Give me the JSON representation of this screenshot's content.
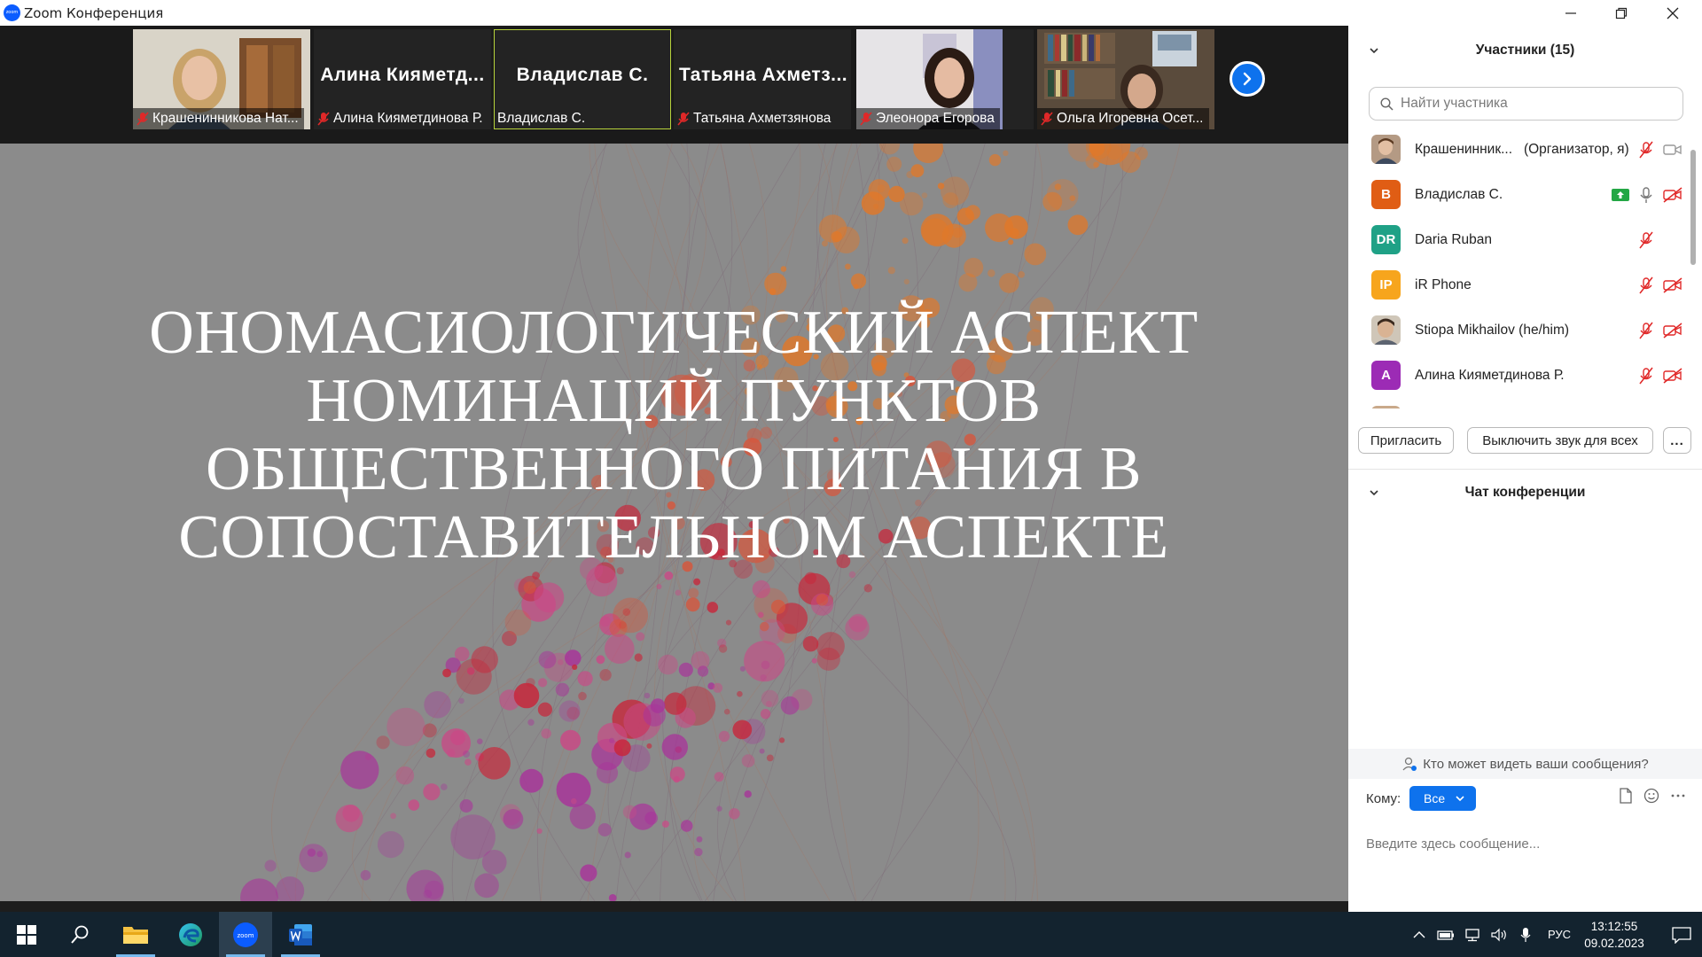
{
  "window": {
    "title": "Zoom Конференция",
    "app_logo_text": "zoom",
    "controls": [
      "minimize",
      "restore",
      "close"
    ]
  },
  "video_strip": {
    "tiles": [
      {
        "display_name": "",
        "label": "Крашенинникова Нат...",
        "muted": true,
        "has_video": true,
        "active": false
      },
      {
        "display_name": "Алина Кияметд...",
        "label": "Алина Кияметдинова Р.",
        "muted": true,
        "has_video": false,
        "active": false
      },
      {
        "display_name": "Владислав С.",
        "label": "Владислав С.",
        "muted": false,
        "has_video": false,
        "active": true
      },
      {
        "display_name": "Татьяна Ахметз...",
        "label": "Татьяна Ахметзянова",
        "muted": true,
        "has_video": false,
        "active": false
      },
      {
        "display_name": "",
        "label": "Элеонора Егорова",
        "muted": true,
        "has_video": true,
        "active": false
      },
      {
        "display_name": "",
        "label": "Ольга Игоревна Осет...",
        "muted": true,
        "has_video": true,
        "active": false
      }
    ],
    "next_icon": "chevron-right-icon"
  },
  "slide": {
    "title_lines": [
      "ОНОМАСИОЛОГИЧЕСКИЙ АСПЕКТ",
      "НОМИНАЦИЙ ПУНКТОВ",
      "ОБЩЕСТВЕННОГО ПИТАНИЯ В",
      "СОПОСТАВИТЕЛЬНОМ АСПЕКТЕ"
    ],
    "background_color": "#8b8b8b"
  },
  "participants": {
    "header": "Участники (15)",
    "search_placeholder": "Найти участника",
    "list": [
      {
        "name": "Крашенинник...",
        "role": "(Организатор, я)",
        "avatar_text": "",
        "avatar_color": "#8a6a55",
        "icons": [
          "mic-muted-icon",
          "video-icon"
        ]
      },
      {
        "name": "Владислав С.",
        "role": "",
        "avatar_text": "В",
        "avatar_color": "#e05d14",
        "icons": [
          "share-screen-icon",
          "mic-icon",
          "video-off-icon"
        ]
      },
      {
        "name": "Daria Ruban",
        "role": "",
        "avatar_text": "DR",
        "avatar_color": "#1fa186",
        "icons": [
          "mic-muted-icon"
        ]
      },
      {
        "name": "iR Phone",
        "role": "",
        "avatar_text": "IP",
        "avatar_color": "#f7a51d",
        "icons": [
          "mic-muted-icon",
          "video-off-icon"
        ]
      },
      {
        "name": "Stiopa Mikhailov (he/him)",
        "role": "",
        "avatar_text": "",
        "avatar_color": "#9a8b7c",
        "icons": [
          "mic-muted-icon",
          "video-off-icon"
        ]
      },
      {
        "name": "Алина Кияметдинова Р.",
        "role": "",
        "avatar_text": "А",
        "avatar_color": "#9c2bb5",
        "icons": [
          "mic-muted-icon",
          "video-off-icon"
        ]
      }
    ],
    "invite_label": "Пригласить",
    "mute_all_label": "Выключить звук для всех",
    "more_label": "..."
  },
  "chat": {
    "header": "Чат конференции",
    "privacy_text": "Кто может видеть ваши сообщения?",
    "to_label": "Кому:",
    "to_value": "Все",
    "input_placeholder": "Введите здесь сообщение..."
  },
  "taskbar": {
    "apps": [
      "windows-start-icon",
      "search-icon",
      "file-explorer-icon",
      "edge-icon",
      "zoom-icon",
      "word-icon"
    ],
    "active_app": "zoom-icon",
    "language": "РУС",
    "time": "13:12:55",
    "date": "09.02.2023"
  },
  "colors": {
    "accent": "#0e72ed",
    "active_speaker_border": "#b7d33b",
    "muted_red": "#e02828",
    "taskbar_bg": "#13232f"
  }
}
